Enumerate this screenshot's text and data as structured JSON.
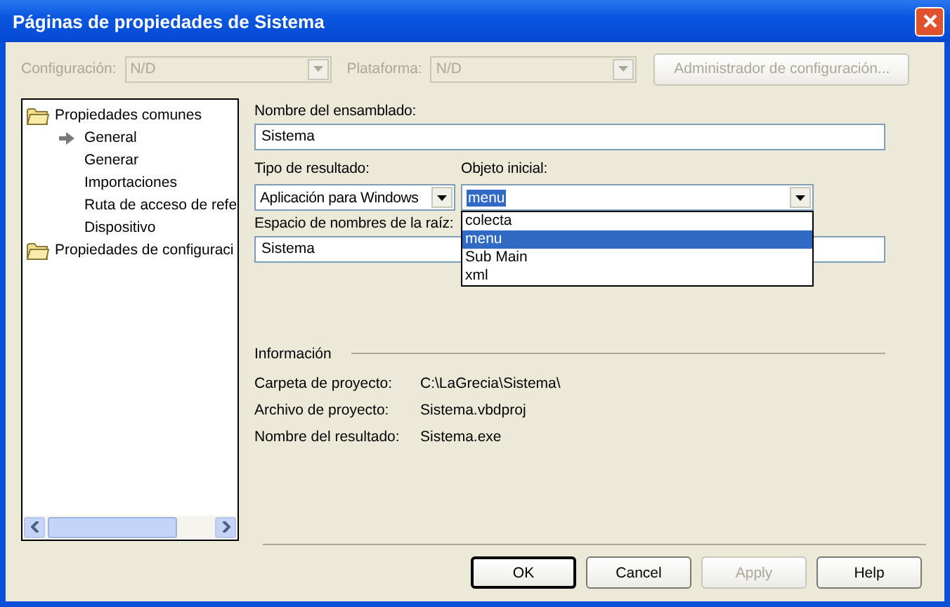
{
  "window": {
    "title": "Páginas de propiedades de Sistema"
  },
  "toolbar": {
    "configuration": {
      "label": "Configuración:",
      "value": "N/D",
      "disabled": true
    },
    "platform": {
      "label": "Plataforma:",
      "value": "N/D",
      "disabled": true
    },
    "manager_button": {
      "label": "Administrador de configuración...",
      "disabled": true
    }
  },
  "tree": [
    {
      "label": "Propiedades comunes",
      "children": [
        {
          "label": "General",
          "selected": true
        },
        {
          "label": "Generar",
          "selected": false
        },
        {
          "label": "Importaciones",
          "selected": false
        },
        {
          "label": "Ruta de acceso de refe",
          "selected": false
        },
        {
          "label": "Dispositivo",
          "selected": false
        }
      ]
    },
    {
      "label": "Propiedades de configuraci"
    }
  ],
  "form": {
    "assembly_name": {
      "label": "Nombre del ensamblado:",
      "value": "Sistema"
    },
    "output_type": {
      "label": "Tipo de resultado:",
      "value": "Aplicación para Windows"
    },
    "startup_object": {
      "label": "Objeto inicial:",
      "value": "menu",
      "open": true,
      "options": [
        {
          "label": "colecta",
          "selected": false
        },
        {
          "label": "menu",
          "selected": true
        },
        {
          "label": "Sub Main",
          "selected": false
        },
        {
          "label": "xml",
          "selected": false
        }
      ]
    },
    "root_namespace": {
      "label": "Espacio de nombres de la raíz:",
      "value": "Sistema"
    }
  },
  "info": {
    "title": "Información",
    "rows": [
      {
        "label": "Carpeta de proyecto:",
        "value": "C:\\LaGrecia\\Sistema\\"
      },
      {
        "label": "Archivo de proyecto:",
        "value": "Sistema.vbdproj"
      },
      {
        "label": "Nombre del resultado:",
        "value": "Sistema.exe"
      }
    ]
  },
  "buttons": [
    {
      "label": "OK",
      "default": true,
      "disabled": false
    },
    {
      "label": "Cancel",
      "default": false,
      "disabled": false
    },
    {
      "label": "Apply",
      "default": false,
      "disabled": true
    },
    {
      "label": "Help",
      "default": false,
      "disabled": false
    }
  ]
}
